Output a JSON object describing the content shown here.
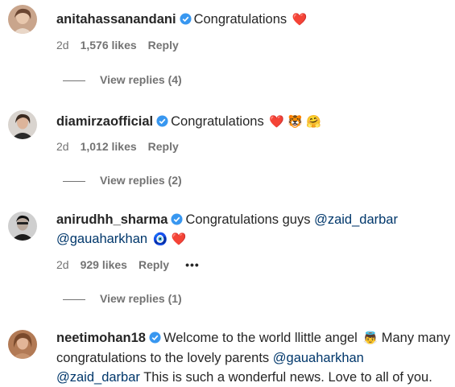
{
  "comments": [
    {
      "username": "anitahassanandani",
      "text": "Congratulations",
      "emojis": "❤️",
      "age": "2d",
      "likes": "1,576 likes",
      "reply_label": "Reply",
      "view_replies": "View replies (4)"
    },
    {
      "username": "diamirzaofficial",
      "text": "Congratulations",
      "emojis": "❤️ 🐯 🤗",
      "age": "2d",
      "likes": "1,012 likes",
      "reply_label": "Reply",
      "view_replies": "View replies (2)"
    },
    {
      "username": "anirudhh_sharma",
      "text": "Congratulations guys",
      "mention1": "@zaid_darbar",
      "mention2": "@gauaharkhan",
      "emojis": "🧿 ❤️",
      "age": "2d",
      "likes": "929 likes",
      "reply_label": "Reply",
      "more": "•••",
      "view_replies": "View replies (1)"
    },
    {
      "username": "neetimohan18",
      "text1": "Welcome to the world llittle angel",
      "emoji": "👼",
      "text2": "Many many congratulations to the lovely parents",
      "mention1": "@gauaharkhan",
      "mention2": "@zaid_darbar",
      "text3": "This is such a wonderful news. Love to all of you."
    }
  ],
  "colors": {
    "text": "#262626",
    "muted": "#737373",
    "mention": "#00376b",
    "verified": "#3897f0"
  }
}
